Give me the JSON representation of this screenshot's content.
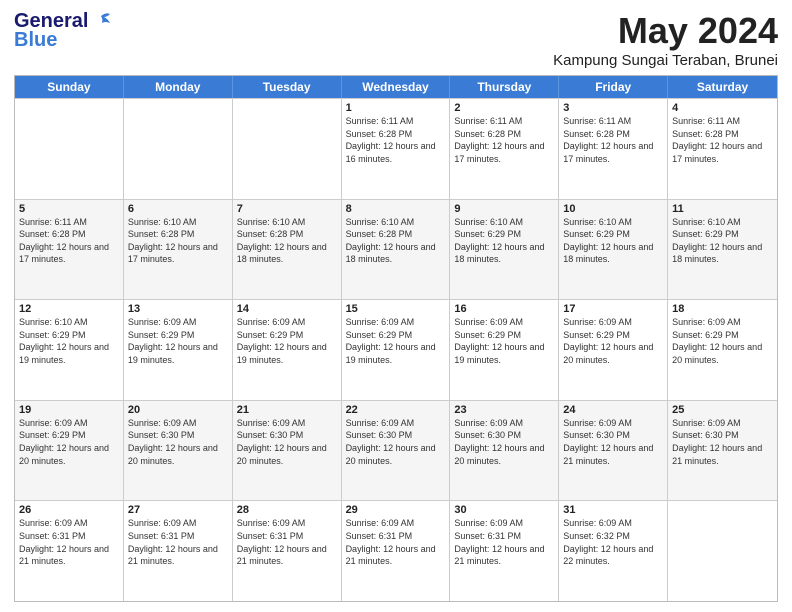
{
  "header": {
    "logo_line1": "General",
    "logo_line2": "Blue",
    "month": "May 2024",
    "location": "Kampung Sungai Teraban, Brunei"
  },
  "days": [
    "Sunday",
    "Monday",
    "Tuesday",
    "Wednesday",
    "Thursday",
    "Friday",
    "Saturday"
  ],
  "weeks": [
    [
      {
        "day": "",
        "sunrise": "",
        "sunset": "",
        "daylight": "",
        "shaded": false
      },
      {
        "day": "",
        "sunrise": "",
        "sunset": "",
        "daylight": "",
        "shaded": false
      },
      {
        "day": "",
        "sunrise": "",
        "sunset": "",
        "daylight": "",
        "shaded": false
      },
      {
        "day": "1",
        "sunrise": "Sunrise: 6:11 AM",
        "sunset": "Sunset: 6:28 PM",
        "daylight": "Daylight: 12 hours and 16 minutes.",
        "shaded": false
      },
      {
        "day": "2",
        "sunrise": "Sunrise: 6:11 AM",
        "sunset": "Sunset: 6:28 PM",
        "daylight": "Daylight: 12 hours and 17 minutes.",
        "shaded": false
      },
      {
        "day": "3",
        "sunrise": "Sunrise: 6:11 AM",
        "sunset": "Sunset: 6:28 PM",
        "daylight": "Daylight: 12 hours and 17 minutes.",
        "shaded": false
      },
      {
        "day": "4",
        "sunrise": "Sunrise: 6:11 AM",
        "sunset": "Sunset: 6:28 PM",
        "daylight": "Daylight: 12 hours and 17 minutes.",
        "shaded": false
      }
    ],
    [
      {
        "day": "5",
        "sunrise": "Sunrise: 6:11 AM",
        "sunset": "Sunset: 6:28 PM",
        "daylight": "Daylight: 12 hours and 17 minutes.",
        "shaded": true
      },
      {
        "day": "6",
        "sunrise": "Sunrise: 6:10 AM",
        "sunset": "Sunset: 6:28 PM",
        "daylight": "Daylight: 12 hours and 17 minutes.",
        "shaded": true
      },
      {
        "day": "7",
        "sunrise": "Sunrise: 6:10 AM",
        "sunset": "Sunset: 6:28 PM",
        "daylight": "Daylight: 12 hours and 18 minutes.",
        "shaded": true
      },
      {
        "day": "8",
        "sunrise": "Sunrise: 6:10 AM",
        "sunset": "Sunset: 6:28 PM",
        "daylight": "Daylight: 12 hours and 18 minutes.",
        "shaded": true
      },
      {
        "day": "9",
        "sunrise": "Sunrise: 6:10 AM",
        "sunset": "Sunset: 6:29 PM",
        "daylight": "Daylight: 12 hours and 18 minutes.",
        "shaded": true
      },
      {
        "day": "10",
        "sunrise": "Sunrise: 6:10 AM",
        "sunset": "Sunset: 6:29 PM",
        "daylight": "Daylight: 12 hours and 18 minutes.",
        "shaded": true
      },
      {
        "day": "11",
        "sunrise": "Sunrise: 6:10 AM",
        "sunset": "Sunset: 6:29 PM",
        "daylight": "Daylight: 12 hours and 18 minutes.",
        "shaded": true
      }
    ],
    [
      {
        "day": "12",
        "sunrise": "Sunrise: 6:10 AM",
        "sunset": "Sunset: 6:29 PM",
        "daylight": "Daylight: 12 hours and 19 minutes.",
        "shaded": false
      },
      {
        "day": "13",
        "sunrise": "Sunrise: 6:09 AM",
        "sunset": "Sunset: 6:29 PM",
        "daylight": "Daylight: 12 hours and 19 minutes.",
        "shaded": false
      },
      {
        "day": "14",
        "sunrise": "Sunrise: 6:09 AM",
        "sunset": "Sunset: 6:29 PM",
        "daylight": "Daylight: 12 hours and 19 minutes.",
        "shaded": false
      },
      {
        "day": "15",
        "sunrise": "Sunrise: 6:09 AM",
        "sunset": "Sunset: 6:29 PM",
        "daylight": "Daylight: 12 hours and 19 minutes.",
        "shaded": false
      },
      {
        "day": "16",
        "sunrise": "Sunrise: 6:09 AM",
        "sunset": "Sunset: 6:29 PM",
        "daylight": "Daylight: 12 hours and 19 minutes.",
        "shaded": false
      },
      {
        "day": "17",
        "sunrise": "Sunrise: 6:09 AM",
        "sunset": "Sunset: 6:29 PM",
        "daylight": "Daylight: 12 hours and 20 minutes.",
        "shaded": false
      },
      {
        "day": "18",
        "sunrise": "Sunrise: 6:09 AM",
        "sunset": "Sunset: 6:29 PM",
        "daylight": "Daylight: 12 hours and 20 minutes.",
        "shaded": false
      }
    ],
    [
      {
        "day": "19",
        "sunrise": "Sunrise: 6:09 AM",
        "sunset": "Sunset: 6:29 PM",
        "daylight": "Daylight: 12 hours and 20 minutes.",
        "shaded": true
      },
      {
        "day": "20",
        "sunrise": "Sunrise: 6:09 AM",
        "sunset": "Sunset: 6:30 PM",
        "daylight": "Daylight: 12 hours and 20 minutes.",
        "shaded": true
      },
      {
        "day": "21",
        "sunrise": "Sunrise: 6:09 AM",
        "sunset": "Sunset: 6:30 PM",
        "daylight": "Daylight: 12 hours and 20 minutes.",
        "shaded": true
      },
      {
        "day": "22",
        "sunrise": "Sunrise: 6:09 AM",
        "sunset": "Sunset: 6:30 PM",
        "daylight": "Daylight: 12 hours and 20 minutes.",
        "shaded": true
      },
      {
        "day": "23",
        "sunrise": "Sunrise: 6:09 AM",
        "sunset": "Sunset: 6:30 PM",
        "daylight": "Daylight: 12 hours and 20 minutes.",
        "shaded": true
      },
      {
        "day": "24",
        "sunrise": "Sunrise: 6:09 AM",
        "sunset": "Sunset: 6:30 PM",
        "daylight": "Daylight: 12 hours and 21 minutes.",
        "shaded": true
      },
      {
        "day": "25",
        "sunrise": "Sunrise: 6:09 AM",
        "sunset": "Sunset: 6:30 PM",
        "daylight": "Daylight: 12 hours and 21 minutes.",
        "shaded": true
      }
    ],
    [
      {
        "day": "26",
        "sunrise": "Sunrise: 6:09 AM",
        "sunset": "Sunset: 6:31 PM",
        "daylight": "Daylight: 12 hours and 21 minutes.",
        "shaded": false
      },
      {
        "day": "27",
        "sunrise": "Sunrise: 6:09 AM",
        "sunset": "Sunset: 6:31 PM",
        "daylight": "Daylight: 12 hours and 21 minutes.",
        "shaded": false
      },
      {
        "day": "28",
        "sunrise": "Sunrise: 6:09 AM",
        "sunset": "Sunset: 6:31 PM",
        "daylight": "Daylight: 12 hours and 21 minutes.",
        "shaded": false
      },
      {
        "day": "29",
        "sunrise": "Sunrise: 6:09 AM",
        "sunset": "Sunset: 6:31 PM",
        "daylight": "Daylight: 12 hours and 21 minutes.",
        "shaded": false
      },
      {
        "day": "30",
        "sunrise": "Sunrise: 6:09 AM",
        "sunset": "Sunset: 6:31 PM",
        "daylight": "Daylight: 12 hours and 21 minutes.",
        "shaded": false
      },
      {
        "day": "31",
        "sunrise": "Sunrise: 6:09 AM",
        "sunset": "Sunset: 6:32 PM",
        "daylight": "Daylight: 12 hours and 22 minutes.",
        "shaded": false
      },
      {
        "day": "",
        "sunrise": "",
        "sunset": "",
        "daylight": "",
        "shaded": false
      }
    ]
  ]
}
